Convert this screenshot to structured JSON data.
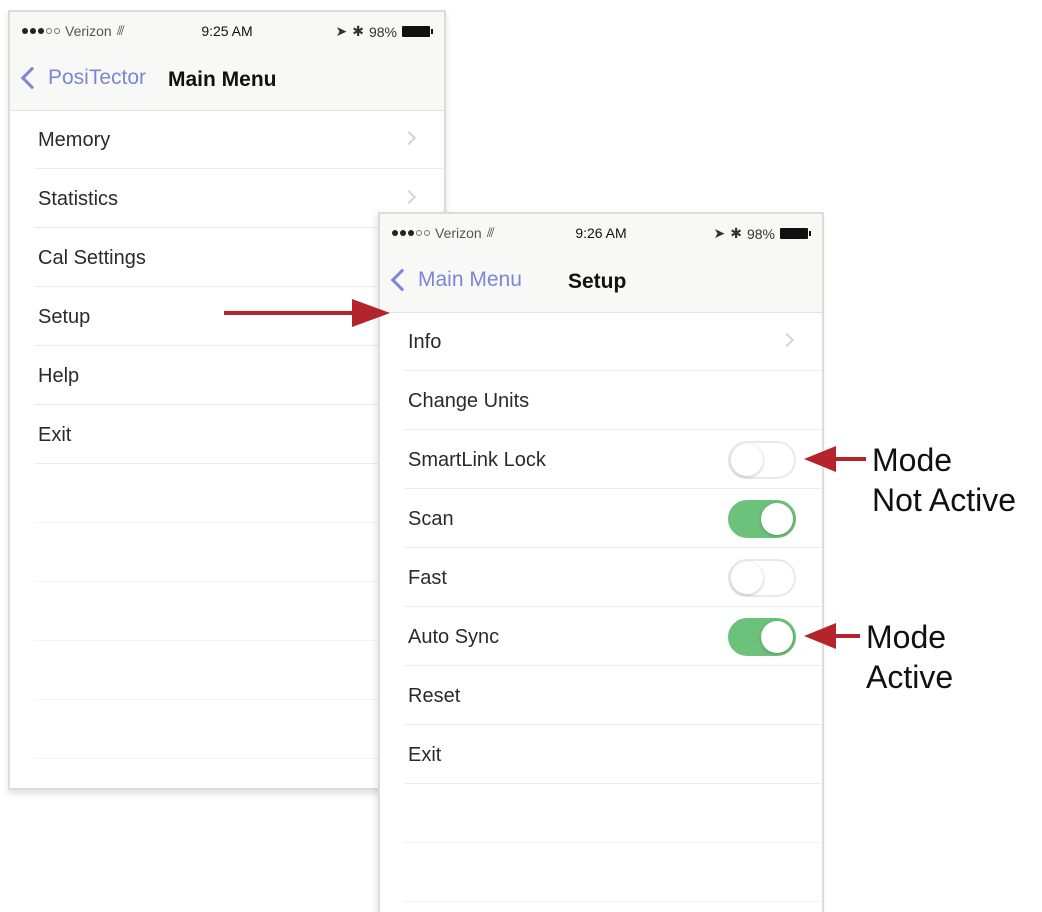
{
  "main_menu": {
    "status": {
      "carrier": "Verizon",
      "time": "9:25 AM",
      "battery": "98%"
    },
    "nav": {
      "back_label": "PosiTector",
      "title": "Main Menu"
    },
    "items": [
      {
        "label": "Memory",
        "chevron": true
      },
      {
        "label": "Statistics",
        "chevron": true
      },
      {
        "label": "Cal Settings",
        "chevron": false
      },
      {
        "label": "Setup",
        "chevron": false
      },
      {
        "label": "Help",
        "chevron": false
      },
      {
        "label": "Exit",
        "chevron": false
      }
    ]
  },
  "setup": {
    "status": {
      "carrier": "Verizon",
      "time": "9:26 AM",
      "battery": "98%"
    },
    "nav": {
      "back_label": "Main Menu",
      "title": "Setup"
    },
    "items": [
      {
        "label": "Info",
        "chevron": true
      },
      {
        "label": "Change Units"
      },
      {
        "label": "SmartLink Lock",
        "toggle": "off"
      },
      {
        "label": "Scan",
        "toggle": "on"
      },
      {
        "label": "Fast",
        "toggle": "off"
      },
      {
        "label": "Auto Sync",
        "toggle": "on"
      },
      {
        "label": "Reset"
      },
      {
        "label": "Exit"
      }
    ]
  },
  "annotations": {
    "not_active": [
      "Mode",
      "Not Active"
    ],
    "active": [
      "Mode",
      "Active"
    ]
  },
  "colors": {
    "accent": "#7d86d6",
    "toggle_on": "#6cc27a",
    "arrow": "#b3242b"
  }
}
